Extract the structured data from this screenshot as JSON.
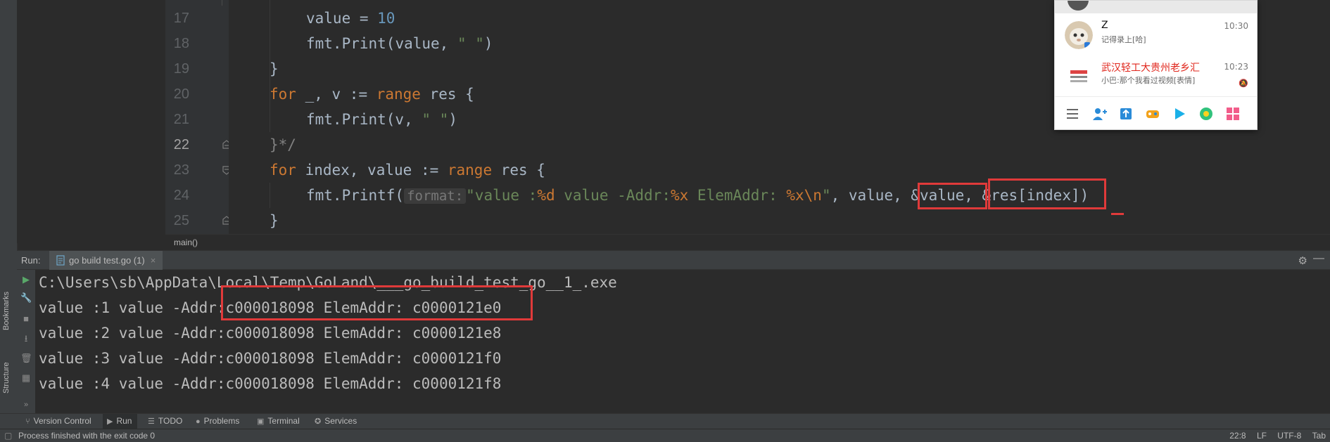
{
  "editor": {
    "lines": [
      {
        "num": "17",
        "tokens": [
          {
            "t": "value = ",
            "c": ""
          },
          {
            "t": "10",
            "c": "num"
          }
        ]
      },
      {
        "num": "18",
        "tokens": [
          {
            "t": "fmt.",
            "c": ""
          },
          {
            "t": "Print",
            "c": ""
          },
          {
            "t": "(value, ",
            "c": ""
          },
          {
            "t": "\" \"",
            "c": "str"
          },
          {
            "t": ")",
            "c": ""
          }
        ]
      },
      {
        "num": "19",
        "tokens": [
          {
            "t": "}",
            "c": ""
          }
        ]
      },
      {
        "num": "20",
        "tokens": [
          {
            "t": "for",
            "c": "kw"
          },
          {
            "t": " _, v := ",
            "c": ""
          },
          {
            "t": "range",
            "c": "kw"
          },
          {
            "t": " res {",
            "c": ""
          }
        ]
      },
      {
        "num": "21",
        "tokens": [
          {
            "t": "fmt.Print(v, ",
            "c": ""
          },
          {
            "t": "\" \"",
            "c": "str"
          },
          {
            "t": ")",
            "c": ""
          }
        ]
      },
      {
        "num": "22",
        "tokens": [
          {
            "t": "}*/",
            "c": "cm"
          }
        ]
      },
      {
        "num": "23",
        "tokens": [
          {
            "t": "for",
            "c": "kw"
          },
          {
            "t": " index, value := ",
            "c": ""
          },
          {
            "t": "range",
            "c": "kw"
          },
          {
            "t": " res {",
            "c": ""
          }
        ]
      },
      {
        "num": "24",
        "tokens": [
          {
            "t": "fmt.Printf(",
            "c": ""
          },
          {
            "t": "format:",
            "c": "hint"
          },
          {
            "t": "\"value :",
            "c": "str"
          },
          {
            "t": "%d",
            "c": "kw"
          },
          {
            "t": " value -Addr:",
            "c": "str"
          },
          {
            "t": "%x",
            "c": "kw"
          },
          {
            "t": " ElemAddr: ",
            "c": "str"
          },
          {
            "t": "%x\\n",
            "c": "kw"
          },
          {
            "t": "\"",
            "c": "str"
          },
          {
            "t": ", value, ",
            "c": ""
          },
          {
            "t": "&value, &res[index])",
            "c": ""
          }
        ]
      },
      {
        "num": "25",
        "tokens": [
          {
            "t": "}",
            "c": ""
          }
        ]
      }
    ],
    "current_line": "22",
    "breadcrumb": "main()"
  },
  "run_panel": {
    "label": "Run:",
    "tab_label": "go build test.go (1)",
    "tab_close": "×",
    "console": [
      "C:\\Users\\sb\\AppData\\Local\\Temp\\GoLand\\___go_build_test_go__1_.exe",
      "value :1 value -Addr:c000018098 ElemAddr: c0000121e0",
      "value :2 value -Addr:c000018098 ElemAddr: c0000121e8",
      "value :3 value -Addr:c000018098 ElemAddr: c0000121f0",
      "value :4 value -Addr:c000018098 ElemAddr: c0000121f8"
    ]
  },
  "side_labels": {
    "bookmarks": "Bookmarks",
    "structure": "Structure"
  },
  "toolwindows": [
    {
      "label": "Version Control",
      "icon": "branch-icon"
    },
    {
      "label": "Run",
      "icon": "play-icon",
      "active": true
    },
    {
      "label": "TODO",
      "icon": "list-icon"
    },
    {
      "label": "Problems",
      "icon": "info-icon"
    },
    {
      "label": "Terminal",
      "icon": "terminal-icon"
    },
    {
      "label": "Services",
      "icon": "services-icon"
    }
  ],
  "status": {
    "message": "Process finished with the exit code 0",
    "position": "22:8",
    "line_sep": "LF",
    "encoding": "UTF-8",
    "indent": "Tab"
  },
  "chat": {
    "items": [
      {
        "name": "Z",
        "message": "记得录上[哈]",
        "time": "10:30",
        "red": false
      },
      {
        "name": "武汉轻工大贵州老乡汇",
        "message": "小巴:那个我看过视频[表情]",
        "time": "10:23",
        "red": true
      }
    ]
  },
  "colors": {
    "accent_red": "#e03a3a",
    "keyword": "#cc7832",
    "string": "#6a8759"
  }
}
